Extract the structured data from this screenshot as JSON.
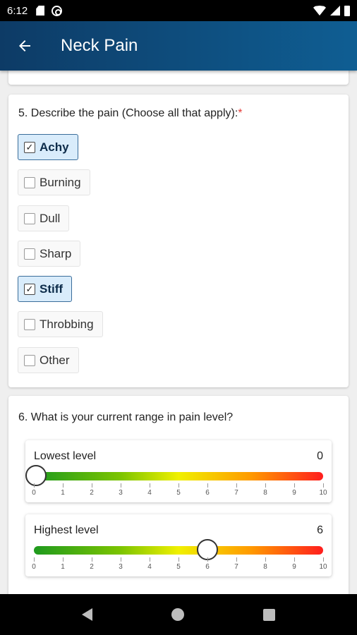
{
  "status_bar": {
    "time": "6:12",
    "icons": [
      "sd-card-icon",
      "at-sign-icon",
      "wifi-icon",
      "signal-icon",
      "battery-icon"
    ]
  },
  "app_bar": {
    "title": "Neck Pain",
    "back_icon": "arrow-left-icon",
    "color_start": "#0d3b66",
    "color_end": "#0f5e93"
  },
  "question5": {
    "title": "5. Describe the pain (Choose all that apply):",
    "required_marker": "*",
    "options": [
      {
        "label": "Achy",
        "checked": true
      },
      {
        "label": "Burning",
        "checked": false
      },
      {
        "label": "Dull",
        "checked": false
      },
      {
        "label": "Sharp",
        "checked": false
      },
      {
        "label": "Stiff",
        "checked": true
      },
      {
        "label": "Throbbing",
        "checked": false
      },
      {
        "label": "Other",
        "checked": false
      }
    ]
  },
  "question6": {
    "title": "6. What is your current range in pain level?",
    "sliders": [
      {
        "label": "Lowest level",
        "value": "0",
        "level": 0
      },
      {
        "label": "Highest level",
        "value": "6",
        "level": 6
      }
    ],
    "scale_min": 0,
    "scale_max": 10,
    "tick_labels": [
      "0",
      "1",
      "2",
      "3",
      "4",
      "5",
      "6",
      "7",
      "8",
      "9",
      "10"
    ]
  },
  "nav_bar": {
    "icons": [
      "nav-back-icon",
      "nav-home-icon",
      "nav-recents-icon"
    ]
  }
}
